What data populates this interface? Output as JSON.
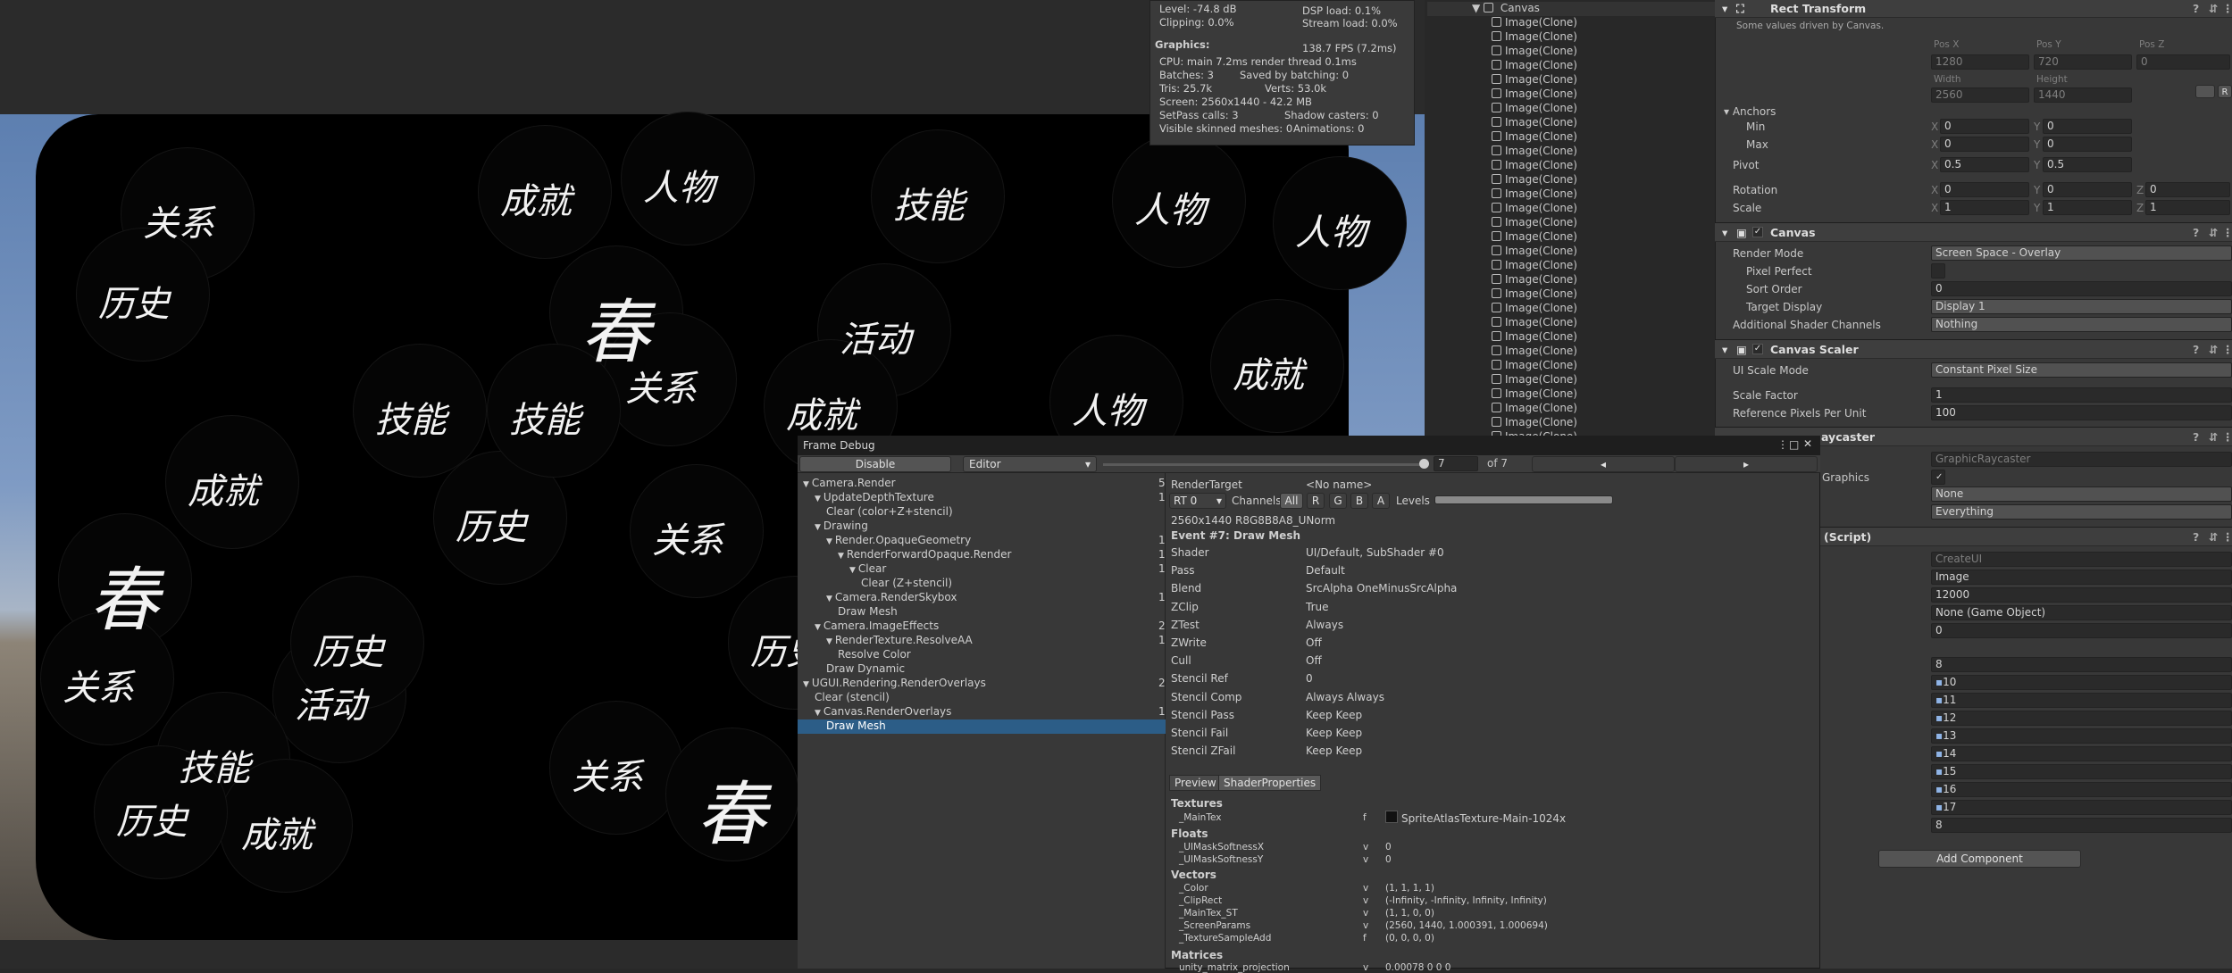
{
  "stats": {
    "level": "Level: -74.8 dB",
    "clipping": "Clipping: 0.0%",
    "dsp": "DSP load: 0.1%",
    "stream": "Stream load: 0.0%",
    "graphics_label": "Graphics:",
    "fps": "138.7 FPS (7.2ms)",
    "cpu": "CPU: main 7.2ms  render thread 0.1ms",
    "batches": "Batches: 3",
    "saved": "Saved by batching: 0",
    "tris": "Tris: 25.7k",
    "verts": "Verts: 53.0k",
    "screen": "Screen: 2560x1440 - 42.2 MB",
    "setpass": "SetPass calls: 3",
    "shadow": "Shadow casters: 0",
    "skinned": "Visible skinned meshes: 0",
    "anims": "Animations: 0"
  },
  "game_glyphs": [
    "关系",
    "成就",
    "技能",
    "人物",
    "历史",
    "春",
    "活动",
    "人物",
    "技能",
    "关系",
    "成就",
    "历史"
  ],
  "hierarchy": {
    "root": "Canvas",
    "child": "Image(Clone)",
    "child_count": 30
  },
  "inspector": {
    "rect_transform": {
      "title": "Rect Transform",
      "note": "Some values driven by Canvas.",
      "posx_label": "Pos X",
      "posy_label": "Pos Y",
      "posz_label": "Pos Z",
      "posx": "1280",
      "posy": "720",
      "posz": "0",
      "width_label": "Width",
      "height_label": "Height",
      "width": "2560",
      "height": "1440",
      "anchors": "Anchors",
      "min": "Min",
      "max": "Max",
      "min_x": "0",
      "min_y": "0",
      "max_x": "0",
      "max_y": "0",
      "pivot": "Pivot",
      "pivot_x": "0.5",
      "pivot_y": "0.5",
      "rotation": "Rotation",
      "rot_x": "0",
      "rot_y": "0",
      "rot_z": "0",
      "scale": "Scale",
      "scale_x": "1",
      "scale_y": "1",
      "scale_z": "1",
      "x": "X",
      "y": "Y",
      "z": "Z"
    },
    "canvas": {
      "title": "Canvas",
      "render_mode_label": "Render Mode",
      "render_mode": "Screen Space - Overlay",
      "pixel_perfect": "Pixel Perfect",
      "sort_order_label": "Sort Order",
      "sort_order": "0",
      "target_display_label": "Target Display",
      "target_display": "Display 1",
      "shader_channels_label": "Additional Shader Channels",
      "shader_channels": "Nothing"
    },
    "scaler": {
      "title": "Canvas Scaler",
      "ui_scale_label": "UI Scale Mode",
      "ui_scale": "Constant Pixel Size",
      "scale_factor_label": "Scale Factor",
      "scale_factor": "1",
      "ref_ppu_label": "Reference Pixels Per Unit",
      "ref_ppu": "100"
    },
    "raycaster": {
      "title": "aycaster",
      "script": "GraphicRaycaster",
      "graphics": "Graphics",
      "blocking_objects": "None",
      "blocking_mask": "Everything"
    },
    "script": {
      "title": "(Script)",
      "script_value": "CreateUI",
      "image_value": "Image",
      "num": "12000",
      "go": "None (Game Object)",
      "zero": "0",
      "eight": "8",
      "list": [
        "10",
        "11",
        "12",
        "13",
        "14",
        "15",
        "16",
        "17"
      ],
      "eight2": "8"
    },
    "add_component": "Add Component"
  },
  "frame_debug": {
    "title": "Frame Debug",
    "disable": "Disable",
    "editor": "Editor",
    "event_index": "7",
    "of": "of 7",
    "events": [
      {
        "label": "Camera.Render",
        "count": "5",
        "level": 0,
        "arrow": "▼"
      },
      {
        "label": "UpdateDepthTexture",
        "count": "1",
        "level": 1,
        "arrow": "▼"
      },
      {
        "label": "Clear (color+Z+stencil)",
        "count": "",
        "level": 2,
        "arrow": ""
      },
      {
        "label": "Drawing",
        "count": "",
        "level": 1,
        "arrow": "▼"
      },
      {
        "label": "Render.OpaqueGeometry",
        "count": "1",
        "level": 2,
        "arrow": "▼"
      },
      {
        "label": "RenderForwardOpaque.Render",
        "count": "1",
        "level": 3,
        "arrow": "▼"
      },
      {
        "label": "Clear",
        "count": "1",
        "level": 4,
        "arrow": "▼"
      },
      {
        "label": "Clear (Z+stencil)",
        "count": "",
        "level": 5,
        "arrow": ""
      },
      {
        "label": "Camera.RenderSkybox",
        "count": "1",
        "level": 2,
        "arrow": "▼"
      },
      {
        "label": "Draw Mesh",
        "count": "",
        "level": 3,
        "arrow": ""
      },
      {
        "label": "Camera.ImageEffects",
        "count": "2",
        "level": 1,
        "arrow": "▼"
      },
      {
        "label": "RenderTexture.ResolveAA",
        "count": "1",
        "level": 2,
        "arrow": "▼"
      },
      {
        "label": "Resolve Color",
        "count": "",
        "level": 3,
        "arrow": ""
      },
      {
        "label": "Draw Dynamic",
        "count": "",
        "level": 2,
        "arrow": ""
      },
      {
        "label": "UGUI.Rendering.RenderOverlays",
        "count": "2",
        "level": 0,
        "arrow": "▼"
      },
      {
        "label": "Clear (stencil)",
        "count": "",
        "level": 1,
        "arrow": ""
      },
      {
        "label": "Canvas.RenderOverlays",
        "count": "1",
        "level": 1,
        "arrow": "▼"
      },
      {
        "label": "Draw Mesh",
        "count": "",
        "level": 2,
        "arrow": "",
        "selected": true
      }
    ],
    "render_target_label": "RenderTarget",
    "render_target": "<No name>",
    "rt": "RT 0",
    "channels_label": "Channels",
    "channels": [
      "All",
      "R",
      "G",
      "B",
      "A"
    ],
    "levels_label": "Levels",
    "format": "2560x1440 R8G8B8A8_UNorm",
    "event_title": "Event #7: Draw Mesh",
    "props": [
      [
        "Shader",
        "UI/Default, SubShader #0"
      ],
      [
        "Pass",
        "Default"
      ],
      [
        "Blend",
        "SrcAlpha OneMinusSrcAlpha"
      ],
      [
        "ZClip",
        "True"
      ],
      [
        "ZTest",
        "Always"
      ],
      [
        "ZWrite",
        "Off"
      ],
      [
        "Cull",
        "Off"
      ],
      [
        "Stencil Ref",
        "0"
      ],
      [
        "Stencil Comp",
        "Always Always"
      ],
      [
        "Stencil Pass",
        "Keep Keep"
      ],
      [
        "Stencil Fail",
        "Keep Keep"
      ],
      [
        "Stencil ZFail",
        "Keep Keep"
      ]
    ],
    "tab_preview": "Preview",
    "tab_shader": "ShaderProperties",
    "textures_label": "Textures",
    "maintex": [
      "_MainTex",
      "f",
      "SpriteAtlasTexture-Main-1024x"
    ],
    "floats_label": "Floats",
    "floats": [
      [
        "_UIMaskSoftnessX",
        "v",
        "0"
      ],
      [
        "_UIMaskSoftnessY",
        "v",
        "0"
      ]
    ],
    "vectors_label": "Vectors",
    "vectors": [
      [
        "_Color",
        "v",
        "(1, 1, 1, 1)"
      ],
      [
        "_ClipRect",
        "v",
        "(-Infinity, -Infinity, Infinity, Infinity)"
      ],
      [
        "_MainTex_ST",
        "v",
        "(1, 1, 0, 0)"
      ],
      [
        "_ScreenParams",
        "v",
        "(2560, 1440, 1.000391, 1.000694)"
      ],
      [
        "_TextureSampleAdd",
        "f",
        "(0, 0, 0, 0)"
      ]
    ],
    "matrices_label": "Matrices",
    "matrix_row": [
      "unity_matrix_projection",
      "v",
      "0.00078    0         0         0"
    ]
  }
}
